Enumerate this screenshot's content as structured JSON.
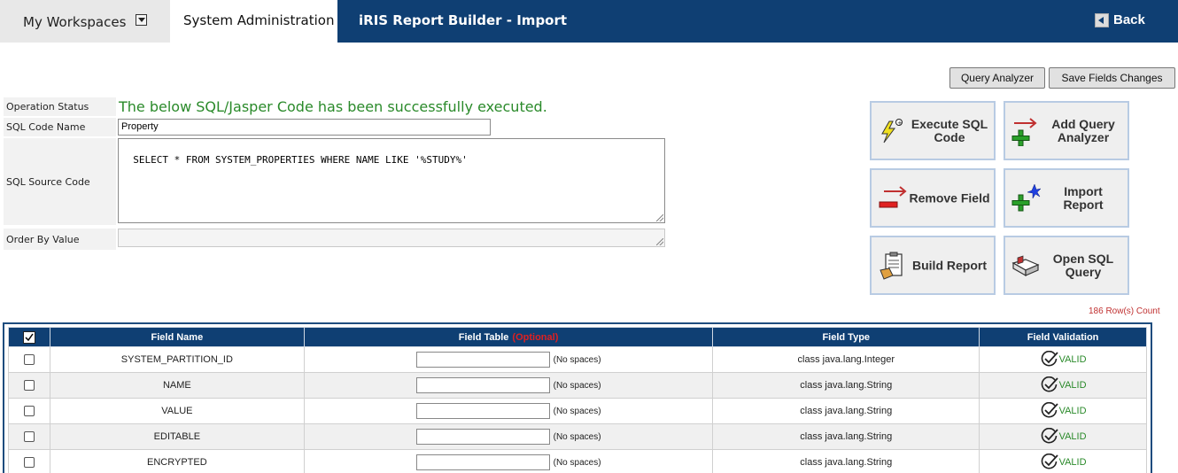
{
  "header": {
    "workspaces_tab": "My Workspaces",
    "admin_tab": "System Administration",
    "title": "iRIS Report Builder - Import",
    "back_label": "Back"
  },
  "toolbar": {
    "query_analyzer": "Query Analyzer",
    "save_fields": "Save Fields Changes"
  },
  "form": {
    "operation_status_label": "Operation Status",
    "operation_status_value": "The below SQL/Jasper Code has been successfully executed.",
    "sql_code_name_label": "SQL Code Name",
    "sql_code_name_value": "Property",
    "sql_source_label": "SQL Source Code",
    "sql_source_value": "SELECT * FROM SYSTEM_PROPERTIES WHERE NAME LIKE '%STUDY%'",
    "order_by_label": "Order By Value",
    "order_by_value": ""
  },
  "actions": {
    "execute_sql": "Execute SQL Code",
    "add_query": "Add Query Analyzer",
    "remove_field": "Remove Field",
    "import_report": "Import Report",
    "build_report": "Build Report",
    "open_sql": "Open SQL Query"
  },
  "row_count": "186 Row(s) Count",
  "table": {
    "headers": {
      "field_name": "Field Name",
      "field_table": "Field Table",
      "optional": "(Optional)",
      "field_type": "Field Type",
      "field_validation": "Field Validation"
    },
    "no_spaces": "(No spaces)",
    "rows": [
      {
        "name": "SYSTEM_PARTITION_ID",
        "type": "class java.lang.Integer",
        "validation": "VALID"
      },
      {
        "name": "NAME",
        "type": "class java.lang.String",
        "validation": "VALID"
      },
      {
        "name": "VALUE",
        "type": "class java.lang.String",
        "validation": "VALID"
      },
      {
        "name": "EDITABLE",
        "type": "class java.lang.String",
        "validation": "VALID"
      },
      {
        "name": "ENCRYPTED",
        "type": "class java.lang.String",
        "validation": "VALID"
      }
    ]
  }
}
